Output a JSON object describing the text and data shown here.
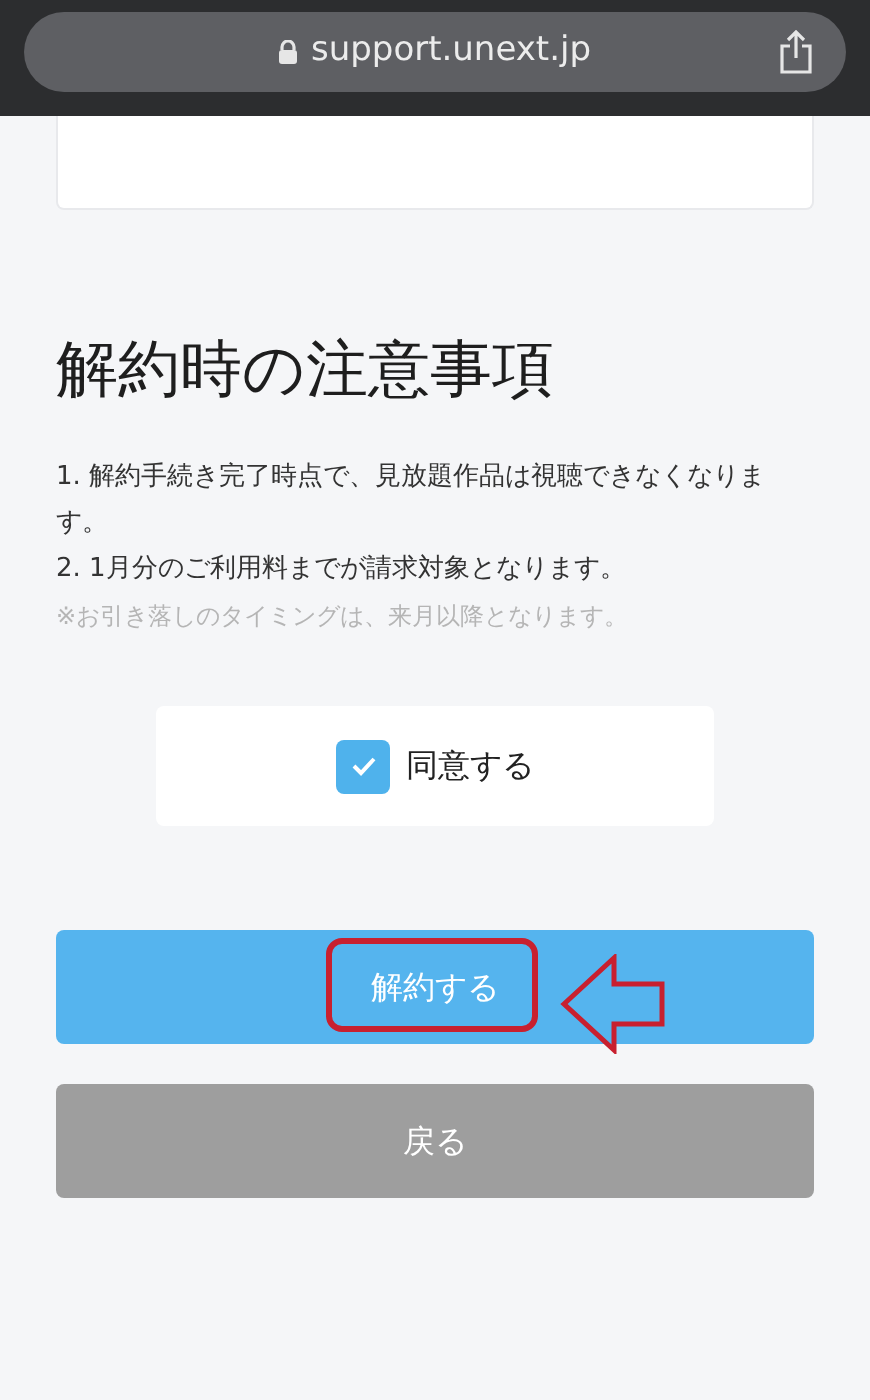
{
  "address_bar": {
    "url": "support.unext.jp",
    "secure": true
  },
  "section": {
    "title": "解約時の注意事項",
    "notes": [
      "1. 解約手続き完了時点で、見放題作品は視聴できなくなります。",
      "2. 1月分のご利用料までが請求対象となります。"
    ],
    "footnote": "※お引き落しのタイミングは、来月以降となります。"
  },
  "agreement": {
    "label": "同意する",
    "checked": true
  },
  "buttons": [
    {
      "label": "解約する",
      "kind": "primary",
      "annotated": true
    },
    {
      "label": "戻る",
      "kind": "secondary",
      "annotated": false
    }
  ]
}
